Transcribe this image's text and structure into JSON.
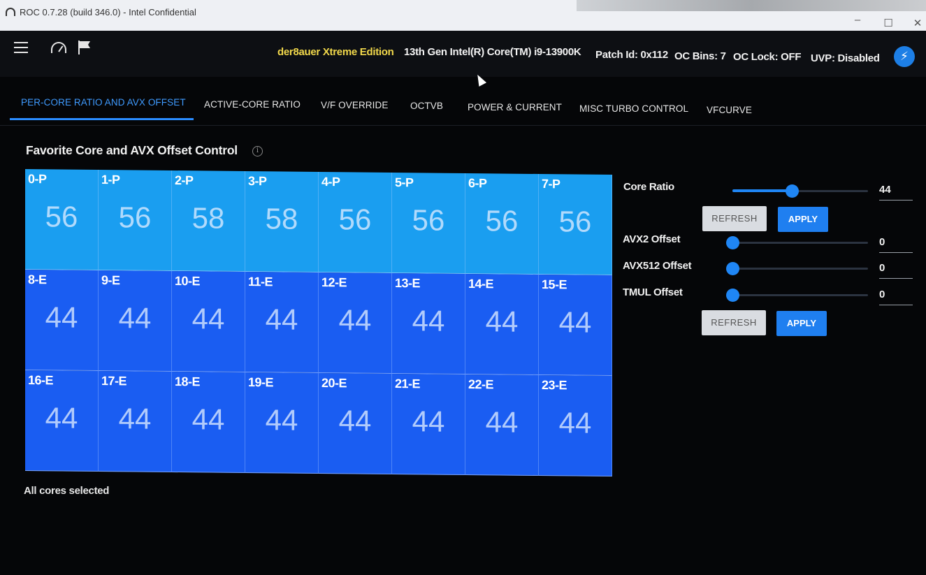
{
  "window": {
    "title": "ROC 0.7.28 (build 346.0) - Intel Confidential",
    "controls": {
      "minimize": "–",
      "maximize": "☐",
      "close": "✕"
    }
  },
  "header": {
    "edition": "der8auer Xtreme Edition",
    "cpu": "13th Gen Intel(R) Core(TM) i9-13900K",
    "patch_id": "Patch Id: 0x112",
    "oc_bins": "OC Bins: 7",
    "oc_lock": "OC Lock: OFF",
    "uvp": "UVP: Disabled",
    "icons": [
      "hamburger-menu-icon",
      "gauge-icon",
      "flag-icon",
      "lightning-bolt-icon"
    ],
    "bolt_symbol": "⚡"
  },
  "tabs": [
    {
      "label": "PER-CORE RATIO AND AVX OFFSET",
      "active": true
    },
    {
      "label": "ACTIVE-CORE RATIO",
      "active": false
    },
    {
      "label": "V/F OVERRIDE",
      "active": false
    },
    {
      "label": "OCTVB",
      "active": false
    },
    {
      "label": "POWER & CURRENT",
      "active": false
    },
    {
      "label": "MISC TURBO CONTROL",
      "active": false
    },
    {
      "label": "VFCURVE",
      "active": false
    }
  ],
  "section": {
    "title": "Favorite Core and AVX Offset Control",
    "info_symbol": "i"
  },
  "cores": [
    {
      "id": "0-P",
      "ratio": "56",
      "type": "p"
    },
    {
      "id": "1-P",
      "ratio": "56",
      "type": "p"
    },
    {
      "id": "2-P",
      "ratio": "58",
      "type": "p"
    },
    {
      "id": "3-P",
      "ratio": "58",
      "type": "p"
    },
    {
      "id": "4-P",
      "ratio": "56",
      "type": "p"
    },
    {
      "id": "5-P",
      "ratio": "56",
      "type": "p"
    },
    {
      "id": "6-P",
      "ratio": "56",
      "type": "p"
    },
    {
      "id": "7-P",
      "ratio": "56",
      "type": "p"
    },
    {
      "id": "8-E",
      "ratio": "44",
      "type": "e"
    },
    {
      "id": "9-E",
      "ratio": "44",
      "type": "e"
    },
    {
      "id": "10-E",
      "ratio": "44",
      "type": "e"
    },
    {
      "id": "11-E",
      "ratio": "44",
      "type": "e"
    },
    {
      "id": "12-E",
      "ratio": "44",
      "type": "e"
    },
    {
      "id": "13-E",
      "ratio": "44",
      "type": "e"
    },
    {
      "id": "14-E",
      "ratio": "44",
      "type": "e"
    },
    {
      "id": "15-E",
      "ratio": "44",
      "type": "e"
    },
    {
      "id": "16-E",
      "ratio": "44",
      "type": "e"
    },
    {
      "id": "17-E",
      "ratio": "44",
      "type": "e"
    },
    {
      "id": "18-E",
      "ratio": "44",
      "type": "e"
    },
    {
      "id": "19-E",
      "ratio": "44",
      "type": "e"
    },
    {
      "id": "20-E",
      "ratio": "44",
      "type": "e"
    },
    {
      "id": "21-E",
      "ratio": "44",
      "type": "e"
    },
    {
      "id": "22-E",
      "ratio": "44",
      "type": "e"
    },
    {
      "id": "23-E",
      "ratio": "44",
      "type": "e"
    }
  ],
  "status": "All cores selected",
  "controls": {
    "core_ratio": {
      "label": "Core Ratio",
      "value": "44",
      "slider_fraction": 0.44
    },
    "avx2_offset": {
      "label": "AVX2 Offset",
      "value": "0",
      "slider_fraction": 0
    },
    "avx512_offset": {
      "label": "AVX512 Offset",
      "value": "0",
      "slider_fraction": 0
    },
    "tmul_offset": {
      "label": "TMUL Offset",
      "value": "0",
      "slider_fraction": 0
    },
    "refresh_label": "REFRESH",
    "apply_label": "APPLY"
  },
  "colors": {
    "accent": "#1f86f5",
    "p_core": "#1a9ef0",
    "e_core": "#1a5df2",
    "edition_text": "#f1d84b",
    "active_tab": "#3f9bff"
  }
}
